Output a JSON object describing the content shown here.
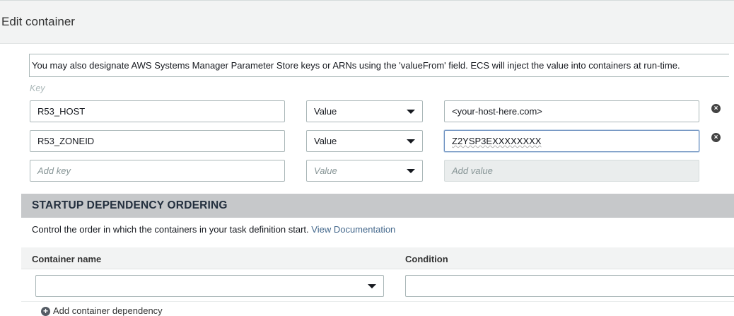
{
  "header": {
    "title": "Edit container"
  },
  "env": {
    "notice": "You may also designate AWS Systems Manager Parameter Store keys or ARNs using the 'valueFrom' field. ECS will inject the value into containers at run-time.",
    "key_caption": "Key",
    "rows": [
      {
        "key": "R53_HOST",
        "type": "Value",
        "value": "<your-host-here.com>"
      },
      {
        "key": "R53_ZONEID",
        "type": "Value",
        "value": "Z2YSP3EXXXXXXXX"
      }
    ],
    "new_row": {
      "key_placeholder": "Add key",
      "type_placeholder": "Value",
      "value_placeholder": "Add value"
    },
    "remove_icon": "×"
  },
  "startup": {
    "title": "STARTUP DEPENDENCY ORDERING",
    "description": "Control the order in which the containers in your task definition start.",
    "doc_link": "View Documentation",
    "columns": {
      "container_name": "Container name",
      "condition": "Condition"
    },
    "add_label": "Add container dependency",
    "add_icon": "+"
  }
}
